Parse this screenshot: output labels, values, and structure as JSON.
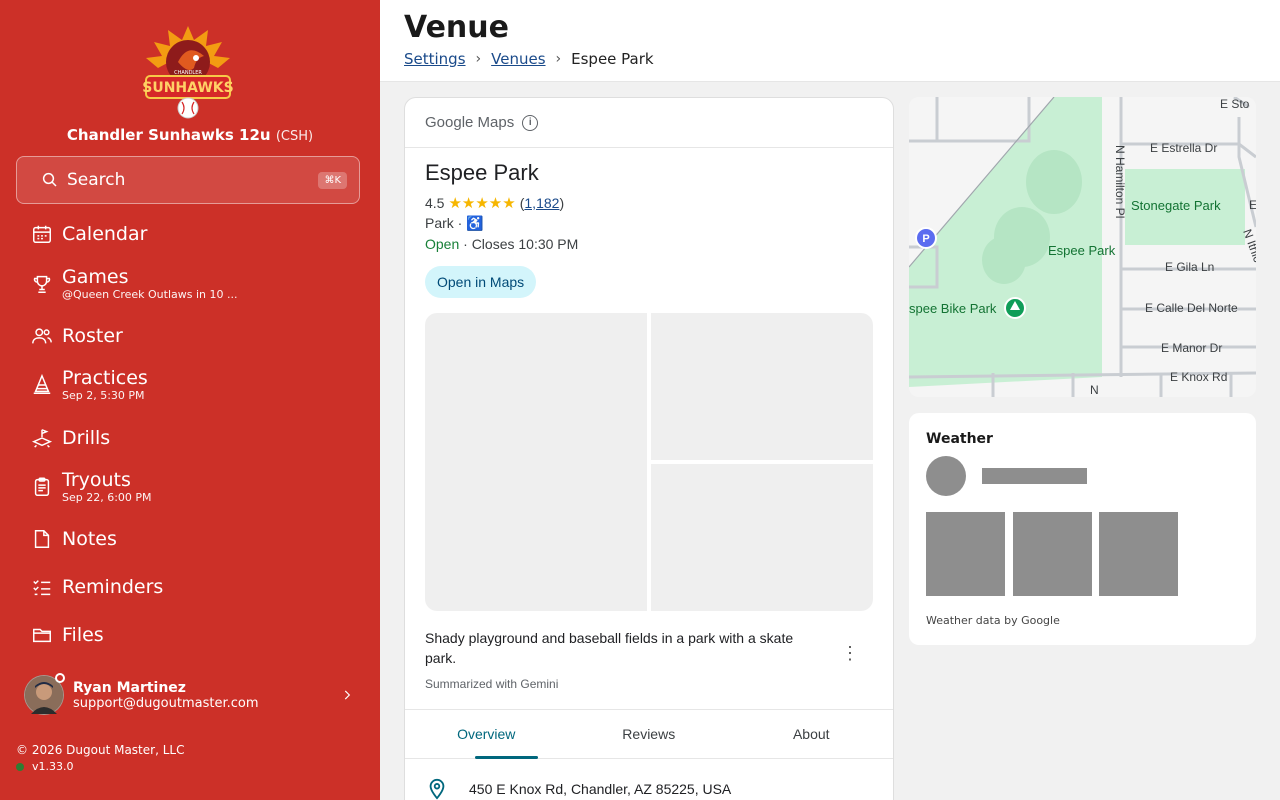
{
  "team": {
    "name": "Chandler Sunhawks 12u",
    "abbr": "(CSH)",
    "logo_text": "SUNHAWKS",
    "logo_top": "CHANDLER"
  },
  "search": {
    "label": "Search",
    "shortcut": "⌘K"
  },
  "nav": [
    {
      "label": "Calendar",
      "sub": "",
      "icon": "calendar-icon"
    },
    {
      "label": "Games",
      "sub": "@Queen Creek Outlaws in 10 ...",
      "icon": "trophy-icon"
    },
    {
      "label": "Roster",
      "sub": "",
      "icon": "people-icon"
    },
    {
      "label": "Practices",
      "sub": "Sep 2, 5:30 PM",
      "icon": "cone-icon"
    },
    {
      "label": "Drills",
      "sub": "",
      "icon": "drill-icon"
    },
    {
      "label": "Tryouts",
      "sub": "Sep 22, 6:00 PM",
      "icon": "clipboard-icon"
    },
    {
      "label": "Notes",
      "sub": "",
      "icon": "note-icon"
    },
    {
      "label": "Reminders",
      "sub": "",
      "icon": "checklist-icon"
    },
    {
      "label": "Files",
      "sub": "",
      "icon": "folder-icon"
    }
  ],
  "user": {
    "name": "Ryan Martinez",
    "email": "support@dugoutmaster.com"
  },
  "footer": {
    "copyright": "© 2026 Dugout Master, LLC",
    "version": "v1.33.0"
  },
  "header": {
    "title": "Venue",
    "breadcrumbs": [
      "Settings",
      "Venues",
      "Espee Park"
    ],
    "sep": "›"
  },
  "place": {
    "provider": "Google Maps",
    "name": "Espee Park",
    "rating": "4.5",
    "stars": "★★★★★",
    "review_count": "1,182",
    "category": "Park ·",
    "accessible": "♿",
    "status": "Open",
    "hours": " · Closes 10:30 PM",
    "open_button": "Open in Maps",
    "summary": "Shady playground and baseball fields in a park with a skate park.",
    "summary_credit": "Summarized with Gemini",
    "tabs": [
      "Overview",
      "Reviews",
      "About"
    ],
    "address": "450 E Knox Rd, Chandler, AZ 85225, USA"
  },
  "map": {
    "labels": {
      "park": "Espee Park",
      "stonegate": "Stonegate Park",
      "bike": "spee Bike Park",
      "estrella": "E Estrella Dr",
      "gila": "E Gila Ln",
      "norte": "E Calle Del Norte",
      "manor": "E Manor Dr",
      "knox": "E Knox Rd",
      "hamilton": "N Hamilton Pl",
      "ithica": "N Ithic",
      "sto": "E Sto",
      "n": "N",
      "e": "E",
      "parking": "P"
    },
    "colors": {
      "park": "#c8efd4",
      "road": "#c9cdd2",
      "bg": "#f5f5f5"
    }
  },
  "weather": {
    "title": "Weather",
    "credit": "Weather data by Google"
  }
}
